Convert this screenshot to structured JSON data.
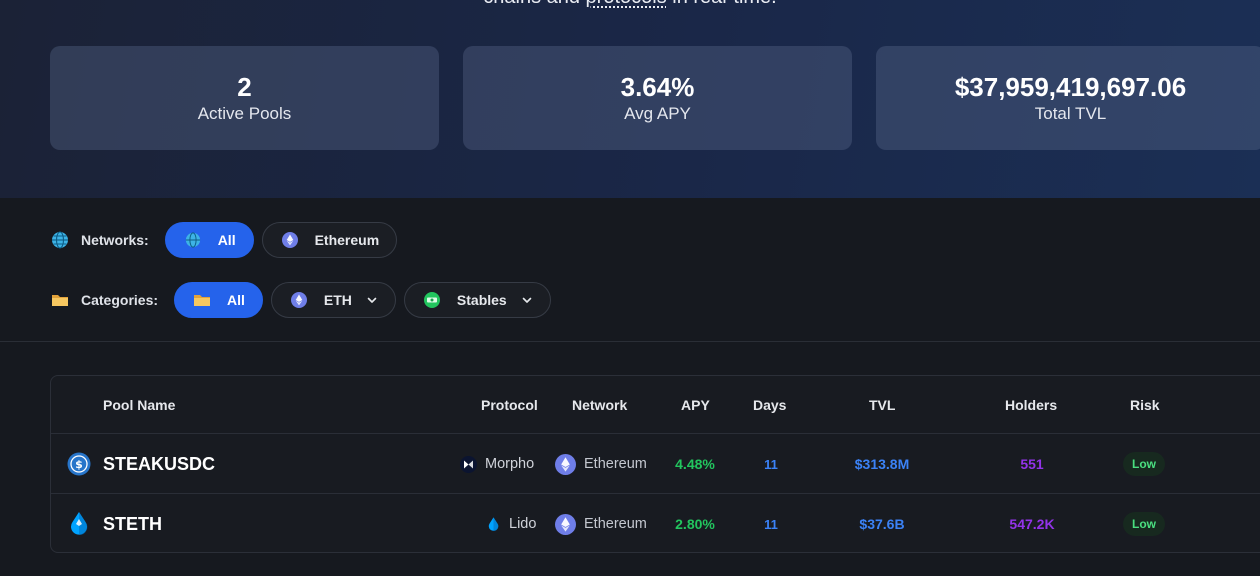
{
  "hero": {
    "subtitle_part1": "chains and ",
    "subtitle_link": "protocols",
    "subtitle_part2": " in real-time.",
    "stats": [
      {
        "value": "2",
        "label": "Active Pools"
      },
      {
        "value": "3.64%",
        "label": "Avg APY"
      },
      {
        "value": "$37,959,419,697.06",
        "label": "Total TVL"
      }
    ]
  },
  "filters": {
    "networks": {
      "label": "Networks:",
      "label_icon": "globe-icon",
      "options": [
        {
          "label": "All",
          "icon": "globe-icon",
          "active": true
        },
        {
          "label": "Ethereum",
          "icon": "ethereum-icon",
          "active": false
        }
      ]
    },
    "categories": {
      "label": "Categories:",
      "label_icon": "folder-icon",
      "options": [
        {
          "label": "All",
          "icon": "folder-icon",
          "active": true
        },
        {
          "label": "ETH",
          "icon": "ethereum-icon",
          "active": false,
          "dropdown": true
        },
        {
          "label": "Stables",
          "icon": "cash-icon",
          "active": false,
          "dropdown": true
        }
      ]
    }
  },
  "table": {
    "headers": [
      "Pool Name",
      "Protocol",
      "Network",
      "APY",
      "Days",
      "TVL",
      "Holders",
      "Risk"
    ],
    "rows": [
      {
        "pool": "STEAKUSDC",
        "pool_icon": "usdc-coin-icon",
        "protocol": "Morpho",
        "protocol_icon": "morpho-icon",
        "network": "Ethereum",
        "network_icon": "ethereum-icon",
        "apy": "4.48%",
        "days": "11",
        "tvl": "$313.8M",
        "holders": "551",
        "risk": "Low"
      },
      {
        "pool": "STETH",
        "pool_icon": "lido-drop-icon",
        "protocol": "Lido",
        "protocol_icon": "lido-drop-icon",
        "network": "Ethereum",
        "network_icon": "ethereum-icon",
        "apy": "2.80%",
        "days": "11",
        "tvl": "$37.6B",
        "holders": "547.2K",
        "risk": "Low"
      }
    ]
  },
  "colors": {
    "accent": "#2563eb",
    "apy_green": "#22c55e",
    "blue_value": "#3b82f6",
    "holders_purple": "#9333ea",
    "risk_low": "#4ade80"
  }
}
